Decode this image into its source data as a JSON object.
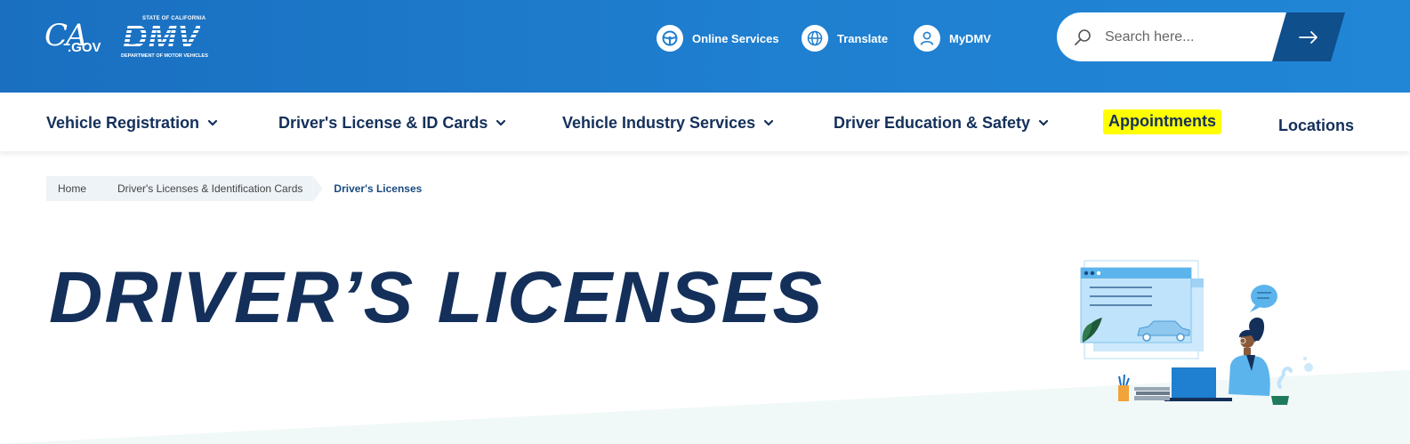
{
  "header": {
    "ca_gov": {
      "ca": "CA",
      "gov": ".GOV"
    },
    "dmv_logo": {
      "state_line": "STATE OF CALIFORNIA",
      "wordmark": "DMV",
      "dept_line": "DEPARTMENT OF MOTOR VEHICLES"
    },
    "utility_links": [
      {
        "label": "Online Services",
        "icon": "steering-wheel-icon"
      },
      {
        "label": "Translate",
        "icon": "globe-icon"
      },
      {
        "label": "MyDMV",
        "icon": "user-icon"
      }
    ],
    "search": {
      "placeholder": "Search here...",
      "submit_icon": "arrow-right-icon"
    }
  },
  "nav": {
    "items": [
      {
        "label": "Vehicle Registration",
        "has_dropdown": true
      },
      {
        "label": "Driver's License & ID Cards",
        "has_dropdown": true
      },
      {
        "label": "Vehicle Industry Services",
        "has_dropdown": true
      },
      {
        "label": "Driver Education & Safety",
        "has_dropdown": true
      },
      {
        "label": "Appointments",
        "highlighted": true
      },
      {
        "label": "Locations"
      }
    ]
  },
  "breadcrumb": [
    {
      "label": "Home"
    },
    {
      "label": "Driver's Licenses & Identification Cards"
    },
    {
      "label": "Driver's Licenses",
      "current": true
    }
  ],
  "page": {
    "title": "DRIVER’S LICENSES"
  },
  "colors": {
    "header_blue": "#1f7fd0",
    "search_button": "#0f4f8c",
    "navy_text": "#14305a",
    "highlight_yellow": "#ffff00",
    "breadcrumb_bg": "#eef3f8",
    "band_bg": "#f1f8f8"
  }
}
